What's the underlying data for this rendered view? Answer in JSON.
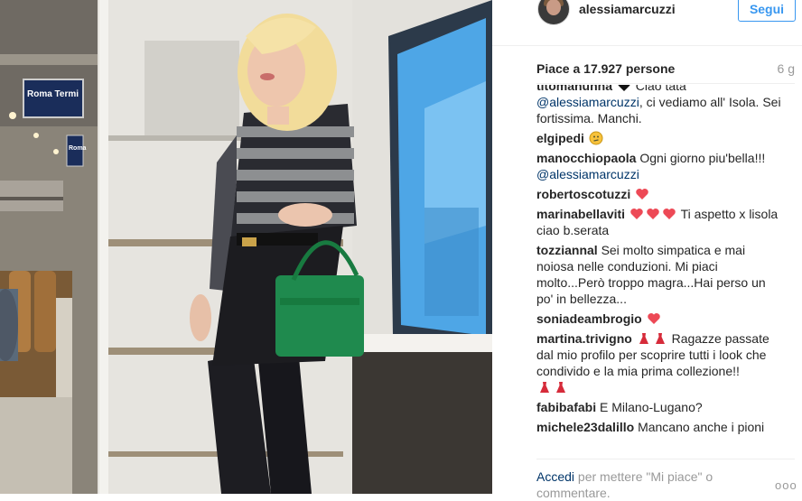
{
  "post": {
    "username": "alessiamarcuzzi",
    "follow_label": "Segui",
    "likes_text": "Piace a 17.927 persone",
    "time_ago": "6 g",
    "photo": {
      "sign_text": "Roma Termi",
      "sign_text_2": "Roma"
    }
  },
  "comments": [
    {
      "user": "titomanunna",
      "text": "Ciao tata",
      "mention": "@alessiamarcuzzi",
      "text_after": ", ci vediamo all' Isola. Sei fortissima. Manchi.",
      "icons": [
        "black-heart-icon"
      ]
    },
    {
      "user": "elgipedi",
      "text": "",
      "mention": "",
      "text_after": "",
      "icons": [
        "thinking-face-icon"
      ]
    },
    {
      "user": "manocchiopaola",
      "text": "Ogni giorno piu'bella!!!",
      "mention": "@alessiamarcuzzi",
      "text_after": "",
      "icons": []
    },
    {
      "user": "robertoscotuzzi",
      "text": "",
      "mention": "",
      "text_after": "",
      "icons": [
        "red-heart-icon"
      ]
    },
    {
      "user": "marinabellaviti",
      "text": "Ti aspetto x lisola ciao b.serata",
      "mention": "",
      "text_after": "",
      "icons": [
        "red-heart-icon",
        "red-heart-icon",
        "red-heart-icon"
      ]
    },
    {
      "user": "tozziannal",
      "text": "Sei molto simpatica e mai noiosa nelle conduzioni. Mi piaci molto...Però troppo magra...Hai perso un po' in bellezza...",
      "mention": "",
      "text_after": "",
      "icons": []
    },
    {
      "user": "soniadeambrogio",
      "text": "",
      "mention": "",
      "text_after": "",
      "icons": [
        "red-heart-icon"
      ]
    },
    {
      "user": "martina.trivigno",
      "text": "Ragazze passate dal mio profilo per scoprire tutti i look che condivido e la mia prima collezione!!",
      "mention": "",
      "text_after": "",
      "icons": [
        "red-dress-icon",
        "red-dress-icon"
      ],
      "trailing_icons": [
        "red-dress-icon",
        "red-dress-icon"
      ]
    },
    {
      "user": "fabibafabi",
      "text": "E Milano-Lugano?",
      "mention": "",
      "text_after": "",
      "icons": []
    },
    {
      "user": "michele23dalillo",
      "text": "Mancano anche i pioni",
      "mention": "",
      "text_after": "",
      "icons": []
    }
  ],
  "footer": {
    "login_link": "Accedi",
    "login_text": "per mettere \"Mi piace\" o commentare.",
    "more_label": "ooo"
  },
  "colors": {
    "accent": "#3897f0",
    "mention": "#003569",
    "heart": "#ed4956"
  }
}
